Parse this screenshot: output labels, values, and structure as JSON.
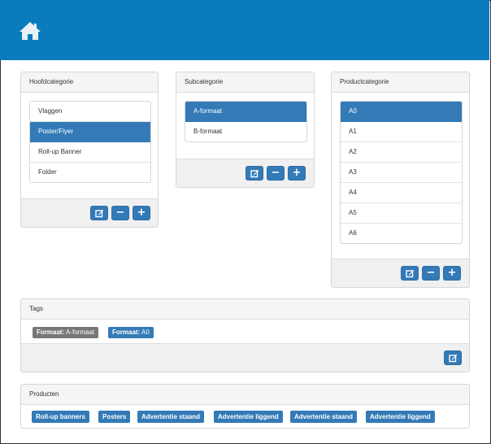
{
  "header": {
    "home_icon": "home-icon"
  },
  "hoofdcategorie": {
    "title": "Hoofdcategorie",
    "items": [
      "Vlaggen",
      "Poster/Flyer",
      "Roll-up Banner",
      "Folder"
    ],
    "selected": "Poster/Flyer"
  },
  "subcategorie": {
    "title": "Subcategorie",
    "items": [
      "A-formaat",
      "B-formaat"
    ],
    "selected": "A-formaat"
  },
  "productcategorie": {
    "title": "Productcategorie",
    "items": [
      "A0",
      "A1",
      "A2",
      "A3",
      "A4",
      "A5",
      "A6"
    ],
    "selected": "A0"
  },
  "buttons": {
    "minus": "−",
    "plus": "+"
  },
  "tags": {
    "title": "Tags",
    "items": [
      {
        "key": "Formaat:",
        "value": "A-formaat",
        "style": "gray"
      },
      {
        "key": "Formaat:",
        "value": "A0",
        "style": "blue"
      }
    ]
  },
  "producten": {
    "title": "Producten",
    "items": [
      "Roll-up banners",
      "Posters",
      "Advertentie staand",
      "Advertentie liggend",
      "Advertentie staand",
      "Advertentie liggend"
    ]
  },
  "colors": {
    "brand": "#0a7bbc",
    "primary": "#337ab7",
    "tag_gray": "#777777"
  }
}
